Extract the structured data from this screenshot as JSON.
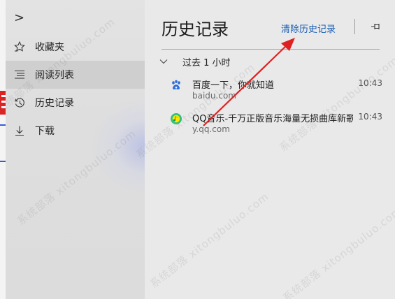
{
  "nav": {
    "toggle_glyph": ">",
    "items": [
      {
        "label": "收藏夹",
        "icon": "star-icon"
      },
      {
        "label": "阅读列表",
        "icon": "reading-list-icon"
      },
      {
        "label": "历史记录",
        "icon": "history-icon"
      },
      {
        "label": "下载",
        "icon": "download-icon"
      }
    ],
    "active_index": 1
  },
  "history": {
    "title": "历史记录",
    "clear_label": "清除历史记录",
    "groups": [
      {
        "label": "过去 1 小时",
        "entries": [
          {
            "title": "百度一下，你就知道",
            "url": "baidu.com",
            "time": "10:43",
            "icon": "baidu-paw-icon"
          },
          {
            "title": "QQ音乐-千万正版音乐海量无损曲库新歌热歌",
            "url": "y.qq.com",
            "time": "10:43",
            "icon": "qq-music-icon"
          }
        ]
      }
    ]
  },
  "watermark": {
    "text": "系统部落 xitongbuluo.com"
  },
  "colors": {
    "link": "#1a5fb4",
    "annotation_arrow": "#e02020",
    "active_nav": "#cfcfcf"
  }
}
